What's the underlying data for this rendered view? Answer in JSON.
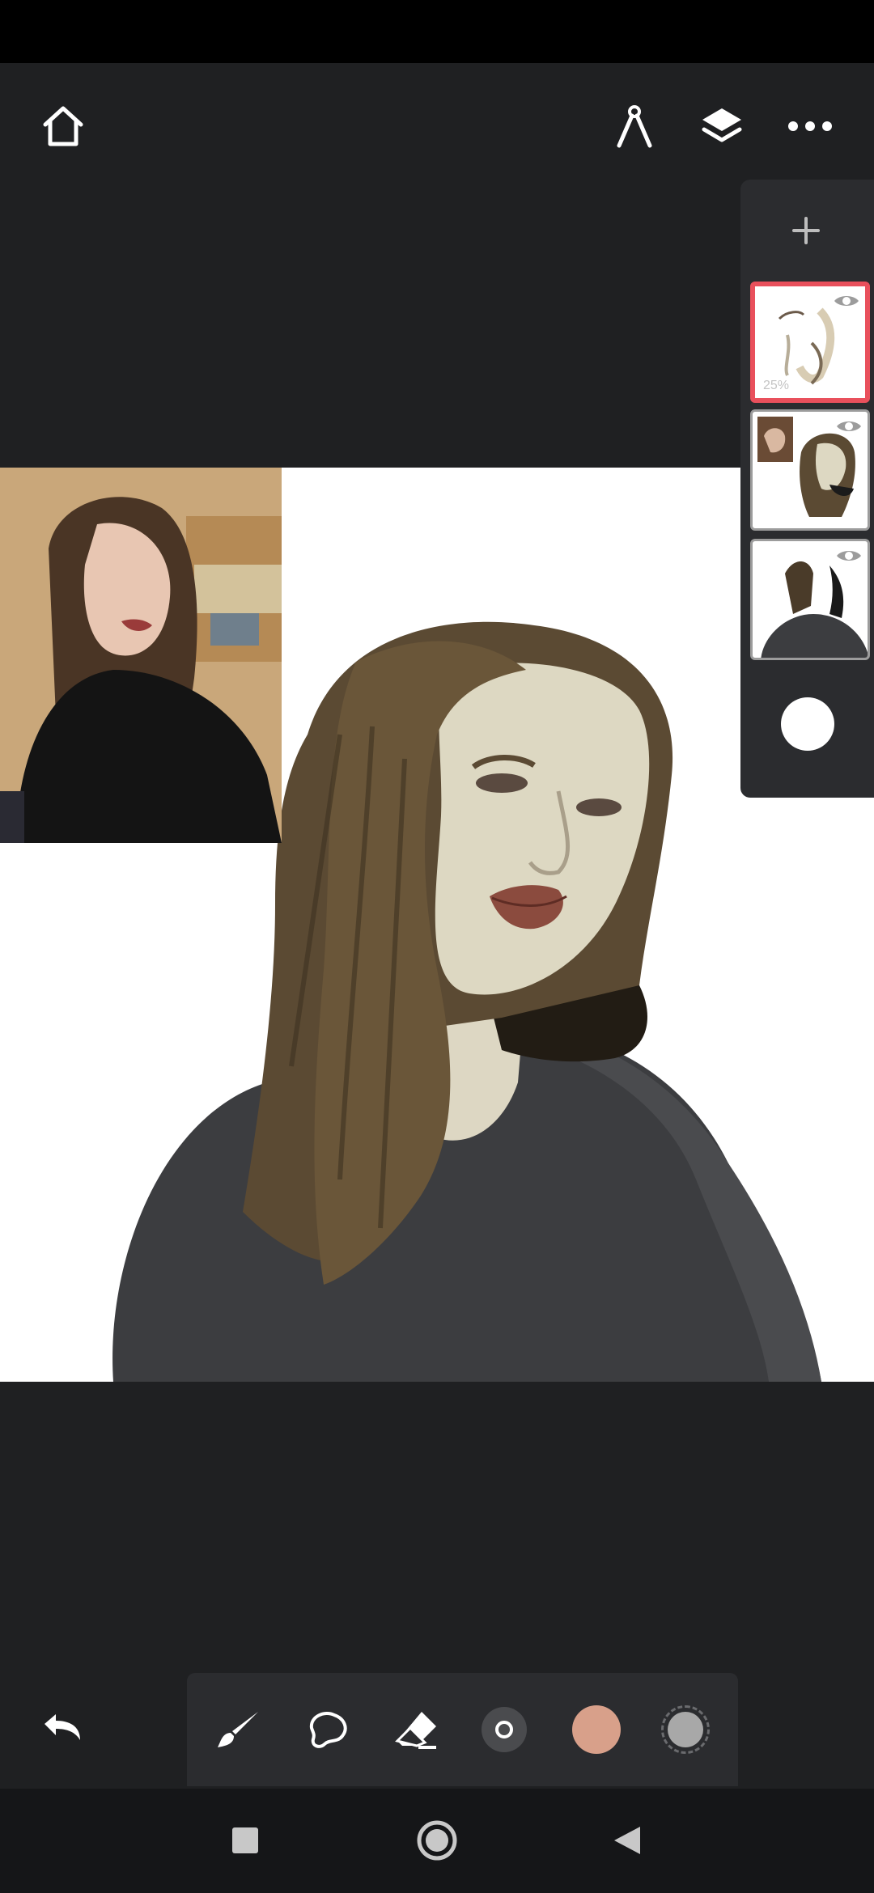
{
  "app": {
    "icons": {
      "home": "home-icon",
      "ruler": "ruler-icon",
      "layers": "layers-icon",
      "more": "more-icon",
      "add_layer": "plus-icon",
      "undo": "undo-icon",
      "brush": "brush-icon",
      "smudge": "smudge-icon",
      "eraser": "eraser-icon",
      "brush_size": "brush-size-icon",
      "color": "color-swatch-icon",
      "opacity": "opacity-swatch-icon"
    }
  },
  "layers": [
    {
      "name": "layer-1",
      "opacity_label": "25%",
      "visible": true,
      "active": true
    },
    {
      "name": "layer-2",
      "opacity_label": "",
      "visible": true,
      "active": false
    },
    {
      "name": "layer-3",
      "opacity_label": "",
      "visible": true,
      "active": false
    }
  ],
  "tools": {
    "current_color": "#d8a08a",
    "opacity_color": "#a8a8a8"
  },
  "colors": {
    "accent": "#e9505c",
    "background": "#1f2022",
    "panel": "#2b2c2f"
  }
}
